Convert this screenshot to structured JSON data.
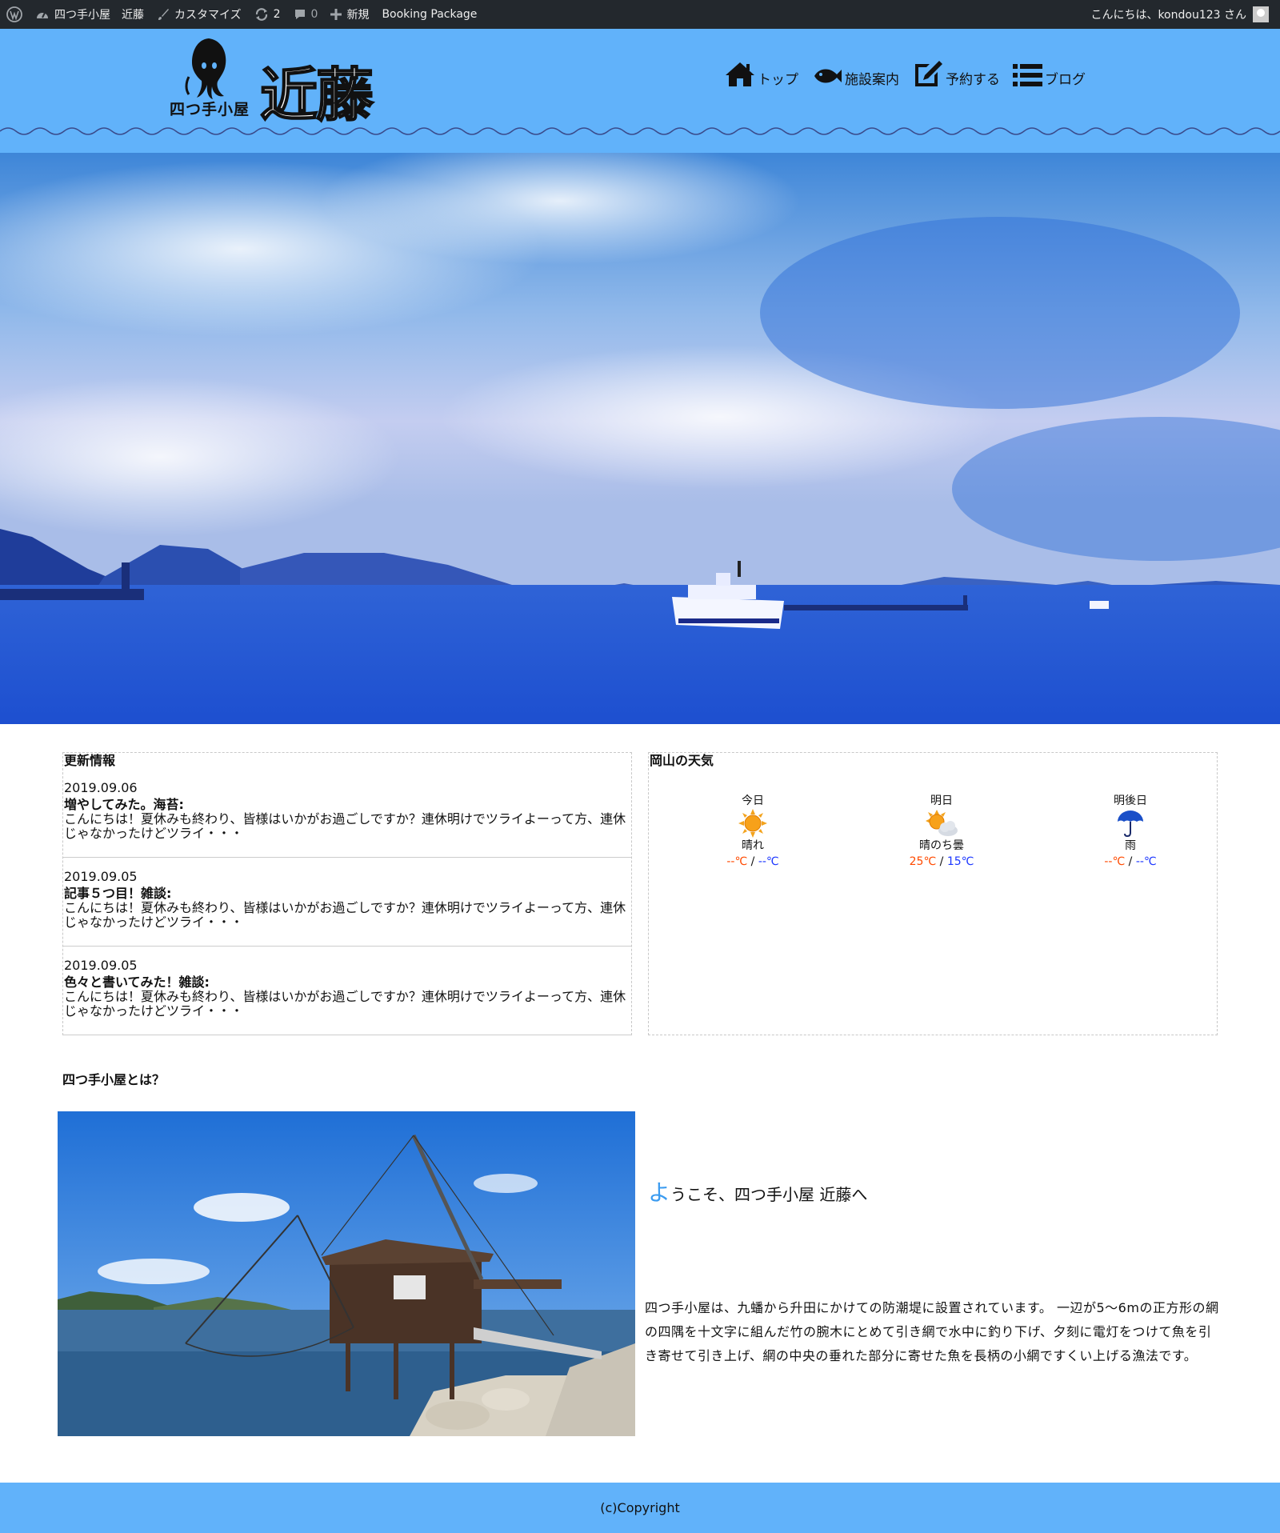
{
  "adminbar": {
    "site_name": "四つ手小屋　近藤",
    "customize": "カスタマイズ",
    "updates_count": "2",
    "comments_count": "0",
    "new_label": "新規",
    "booking_package": "Booking Package",
    "greeting": "こんにちは、kondou123 さん"
  },
  "header": {
    "logo_sub": "四つ手小屋",
    "logo_main": "近藤",
    "nav": [
      {
        "label": "トップ",
        "icon": "home-icon"
      },
      {
        "label": "施設案内",
        "icon": "fish-icon"
      },
      {
        "label": "予約する",
        "icon": "edit-icon"
      },
      {
        "label": "ブログ",
        "icon": "list-icon"
      }
    ]
  },
  "news": {
    "title": "更新情報",
    "items": [
      {
        "date": "2019.09.06",
        "title": "増やしてみた。海苔:",
        "text": "こんにちは！夏休みも終わり、皆様はいかがお過ごしですか？連休明けでツライよーって方、連休じゃなかったけどツライ・・・"
      },
      {
        "date": "2019.09.05",
        "title": "記事５つ目！雑談:",
        "text": "こんにちは！夏休みも終わり、皆様はいかがお過ごしですか？連休明けでツライよーって方、連休じゃなかったけどツライ・・・"
      },
      {
        "date": "2019.09.05",
        "title": "色々と書いてみた！雑談:",
        "text": "こんにちは！夏休みも終わり、皆様はいかがお過ごしですか？連休明けでツライよーって方、連休じゃなかったけどツライ・・・"
      }
    ]
  },
  "weather": {
    "title": "岡山の天気",
    "days": [
      {
        "day": "今日",
        "condition": "晴れ",
        "icon": "sun-icon",
        "high": "--℃",
        "low": "--℃"
      },
      {
        "day": "明日",
        "condition": "晴のち曇",
        "icon": "sun-cloud-icon",
        "high": "25℃",
        "low": "15℃"
      },
      {
        "day": "明後日",
        "condition": "雨",
        "icon": "umbrella-icon",
        "high": "--℃",
        "low": "--℃"
      }
    ],
    "separator": "/"
  },
  "about": {
    "heading": "四つ手小屋とは？",
    "welcome_first": "よ",
    "welcome_rest": "うこそ、四つ手小屋 近藤へ",
    "text": "四つ手小屋は、九蟠から升田にかけての防潮堤に設置されています。 一辺が5〜6mの正方形の網の四隅を十文字に組んだ竹の腕木にとめて引き網で水中に釣り下げ、夕刻に電灯をつけて魚を引き寄せて引き上げ、網の中央の垂れた部分に寄せた魚を長柄の小網ですくい上げる漁法です。"
  },
  "footer": {
    "copyright": "(c)Copyright"
  },
  "colors": {
    "header_bg": "#61b2fa",
    "adminbar_bg": "#23282d",
    "temp_high": "#ff4a00",
    "temp_low": "#1a35ff",
    "welcome_accent": "#3a9bf0"
  }
}
